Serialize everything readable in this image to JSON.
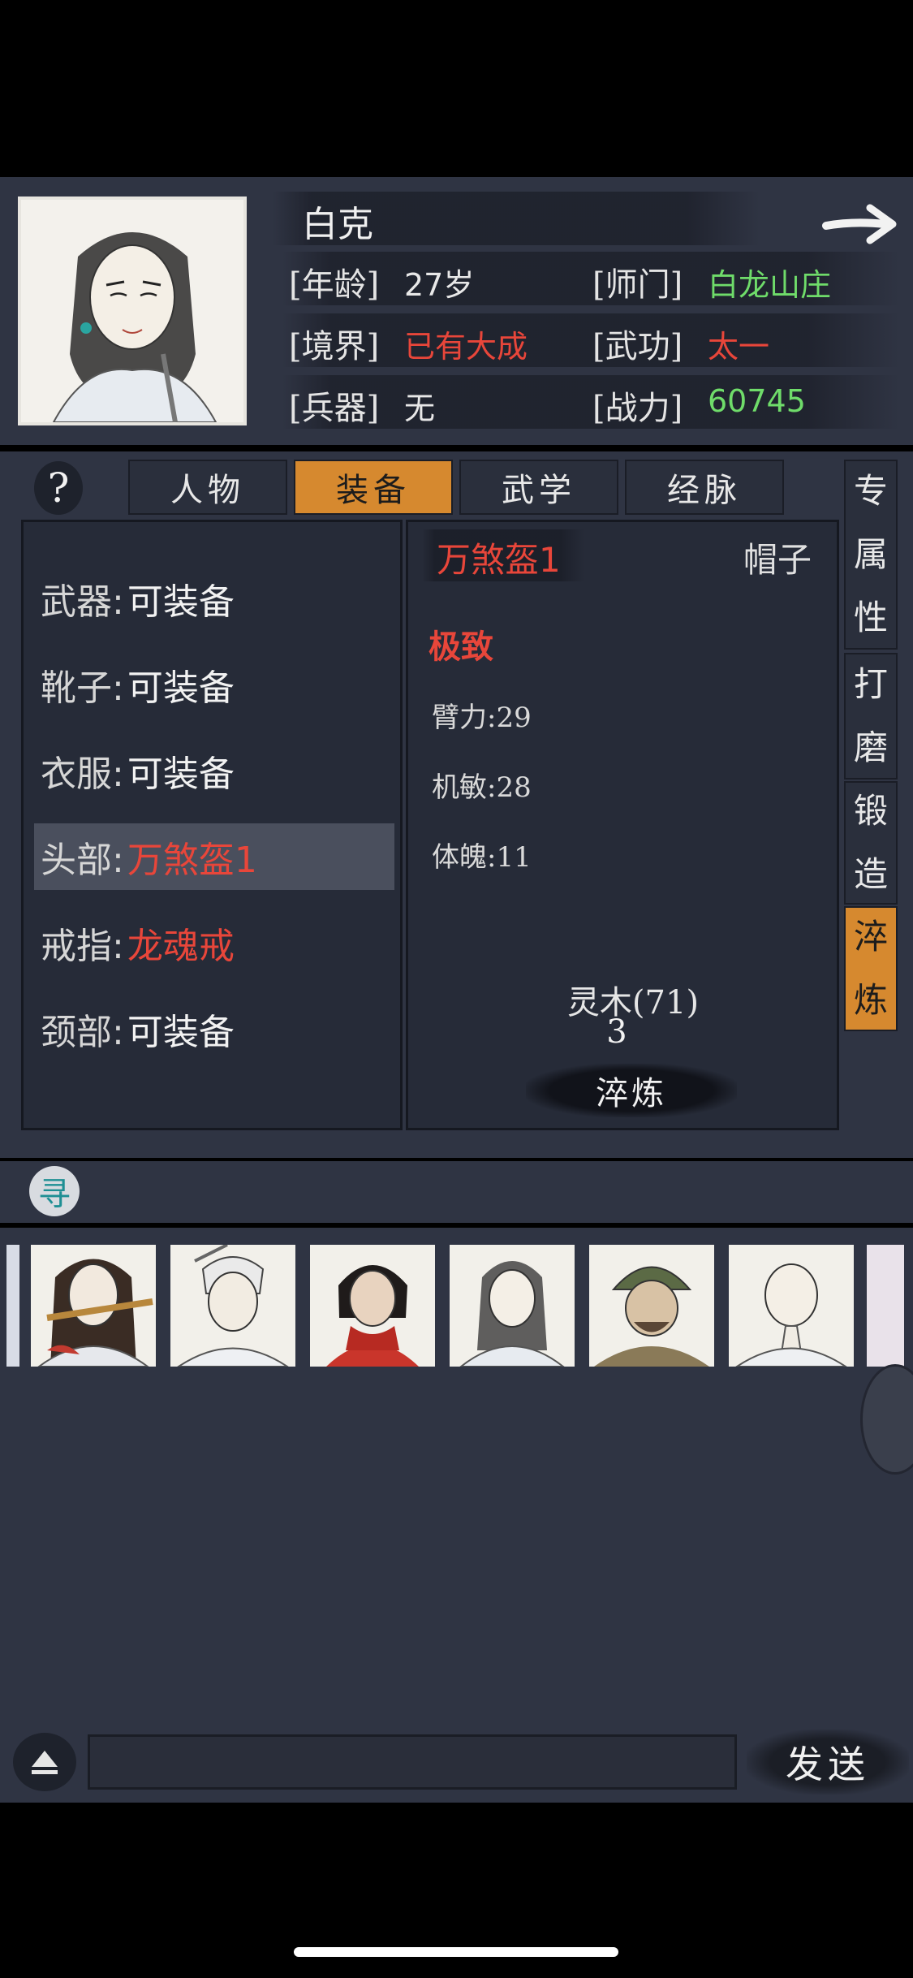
{
  "character": {
    "name": "白克",
    "age_label": "[年龄]",
    "age_value": "27岁",
    "school_label": "[师门]",
    "school_value": "白龙山庄",
    "realm_label": "[境界]",
    "realm_value": "已有大成",
    "skill_label": "[武功]",
    "skill_value": "太一",
    "weapon_label": "[兵器]",
    "weapon_value": "无",
    "power_label": "[战力]",
    "power_value": "60745"
  },
  "help_glyph": "?",
  "tabs": [
    "人物",
    "装备",
    "武学",
    "经脉"
  ],
  "side_tabs": [
    [
      "专",
      "属",
      "性"
    ],
    [
      "打",
      "磨"
    ],
    [
      "锻",
      "造"
    ],
    [
      "淬",
      "炼"
    ]
  ],
  "slots": [
    {
      "key": "武器:",
      "value": "可装备"
    },
    {
      "key": "靴子:",
      "value": "可装备"
    },
    {
      "key": "衣服:",
      "value": "可装备"
    },
    {
      "key": "头部:",
      "value": "万煞盔1"
    },
    {
      "key": "戒指:",
      "value": "龙魂戒"
    },
    {
      "key": "颈部:",
      "value": "可装备"
    }
  ],
  "item": {
    "name": "万煞盔1",
    "type": "帽子",
    "grade": "极致",
    "stats": [
      "臂力:29",
      "机敏:28",
      "体魄:11"
    ],
    "material": "灵木(71)",
    "count": "3",
    "refine_button": "淬炼"
  },
  "search_glyph": "寻",
  "send_button": "发送",
  "colors": {
    "accent_orange": "#d6892f",
    "green": "#6fdc6a",
    "red": "#e8463a"
  },
  "icons": [
    "arrow-right-icon",
    "help-icon",
    "search-icon",
    "eject-icon"
  ]
}
